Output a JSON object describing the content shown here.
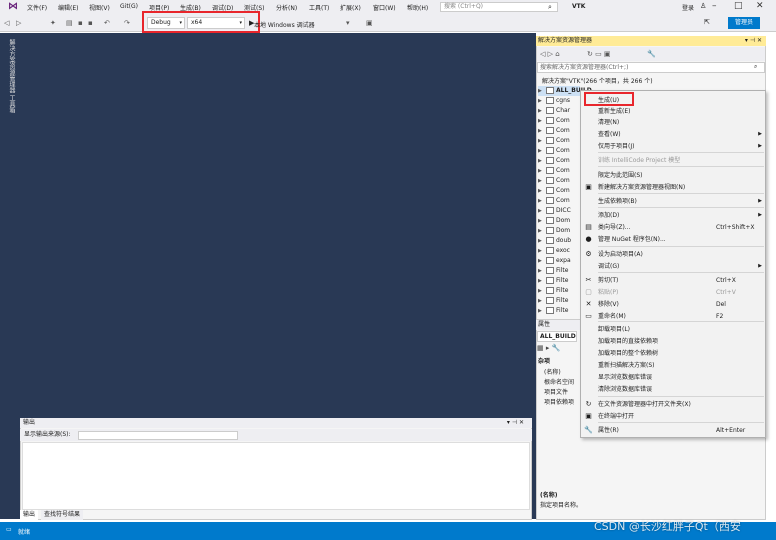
{
  "menu": [
    "文件(F)",
    "编辑(E)",
    "视图(V)",
    "Git(G)",
    "项目(P)",
    "生成(B)",
    "调试(D)",
    "测试(S)",
    "分析(N)",
    "工具(T)",
    "扩展(X)",
    "窗口(W)",
    "帮助(H)"
  ],
  "search_placeholder": "搜索 (Ctrl+Q)",
  "window_title": "VTK",
  "login": "登录",
  "toolbar": {
    "config": "Debug",
    "platform": "x64",
    "run_label": "本地 Windows 调试器",
    "manage": "管理员"
  },
  "sidebar_tabs": [
    "解决方案资源管理器",
    "工具箱"
  ],
  "solution_explorer": {
    "title": "解决方案资源管理器",
    "search_placeholder": "搜索解决方案资源管理器(Ctrl+;)",
    "solution_line": "解决方案\"VTK\"(266 个项目，共 266 个)",
    "items": [
      "ALL_BUILD",
      "cgns",
      "Char",
      "Com",
      "Com",
      "Com",
      "Com",
      "Com",
      "Com",
      "Com",
      "Com",
      "Com",
      "DICC",
      "Dom",
      "Dom",
      "doub",
      "exoc",
      "expa",
      "Filte",
      "Filte",
      "Filte",
      "Filte",
      "Filte"
    ]
  },
  "properties": {
    "title": "属性",
    "object": "ALL_BUILD",
    "category": "杂项",
    "rows": [
      "(名称)",
      "根命名空间",
      "项目文件",
      "项目依赖项"
    ],
    "desc_title": "(名称)",
    "desc": "指定项目名称。"
  },
  "context_menu": [
    {
      "icon": "",
      "label": "生成(U)",
      "shortcut": "",
      "sub": false,
      "disabled": false
    },
    {
      "icon": "",
      "label": "重新生成(E)",
      "shortcut": "",
      "sub": false,
      "disabled": false
    },
    {
      "icon": "",
      "label": "清理(N)",
      "shortcut": "",
      "sub": false,
      "disabled": false
    },
    {
      "icon": "",
      "label": "查看(W)",
      "shortcut": "",
      "sub": true,
      "disabled": false
    },
    {
      "icon": "",
      "label": "仅用于项目(J)",
      "shortcut": "",
      "sub": true,
      "disabled": false
    },
    {
      "icon": "",
      "label": "训练 IntelliCode Project 模型",
      "shortcut": "",
      "sub": false,
      "disabled": true
    },
    {
      "icon": "",
      "label": "限定为此范围(S)",
      "shortcut": "",
      "sub": false,
      "disabled": false
    },
    {
      "icon": "▣",
      "label": "新建解决方案资源管理器视图(N)",
      "shortcut": "",
      "sub": false,
      "disabled": false
    },
    {
      "icon": "",
      "label": "生成依赖项(B)",
      "shortcut": "",
      "sub": true,
      "disabled": false
    },
    {
      "icon": "",
      "label": "添加(D)",
      "shortcut": "",
      "sub": true,
      "disabled": false
    },
    {
      "icon": "▤",
      "label": "类向导(Z)...",
      "shortcut": "Ctrl+Shift+X",
      "sub": false,
      "disabled": false
    },
    {
      "icon": "●",
      "label": "管理 NuGet 程序包(N)...",
      "shortcut": "",
      "sub": false,
      "disabled": false
    },
    {
      "icon": "⚙",
      "label": "设为启动项目(A)",
      "shortcut": "",
      "sub": false,
      "disabled": false
    },
    {
      "icon": "",
      "label": "调试(G)",
      "shortcut": "",
      "sub": true,
      "disabled": false
    },
    {
      "icon": "✂",
      "label": "剪切(T)",
      "shortcut": "Ctrl+X",
      "sub": false,
      "disabled": false
    },
    {
      "icon": "▢",
      "label": "粘贴(P)",
      "shortcut": "Ctrl+V",
      "sub": false,
      "disabled": true
    },
    {
      "icon": "✕",
      "label": "移除(V)",
      "shortcut": "Del",
      "sub": false,
      "disabled": false
    },
    {
      "icon": "▭",
      "label": "重命名(M)",
      "shortcut": "F2",
      "sub": false,
      "disabled": false
    },
    {
      "icon": "",
      "label": "卸载项目(L)",
      "shortcut": "",
      "sub": false,
      "disabled": false
    },
    {
      "icon": "",
      "label": "加载项目的直接依赖项",
      "shortcut": "",
      "sub": false,
      "disabled": false
    },
    {
      "icon": "",
      "label": "加载项目的整个依赖树",
      "shortcut": "",
      "sub": false,
      "disabled": false
    },
    {
      "icon": "",
      "label": "重新扫描解决方案(S)",
      "shortcut": "",
      "sub": false,
      "disabled": false
    },
    {
      "icon": "",
      "label": "显示浏览数据库错误",
      "shortcut": "",
      "sub": false,
      "disabled": false
    },
    {
      "icon": "",
      "label": "清除浏览数据库错误",
      "shortcut": "",
      "sub": false,
      "disabled": false
    },
    {
      "icon": "↻",
      "label": "在文件资源管理器中打开文件夹(X)",
      "shortcut": "",
      "sub": false,
      "disabled": false
    },
    {
      "icon": "▣",
      "label": "在终端中打开",
      "shortcut": "",
      "sub": false,
      "disabled": false
    },
    {
      "icon": "🔧",
      "label": "属性(R)",
      "shortcut": "Alt+Enter",
      "sub": false,
      "disabled": false
    }
  ],
  "output": {
    "title": "输出",
    "source_label": "显示输出来源(S):",
    "tabs": [
      "输出",
      "查找符号结果"
    ]
  },
  "status": "就绪",
  "watermark": "CSDN @长沙红胖子Qt（西安"
}
